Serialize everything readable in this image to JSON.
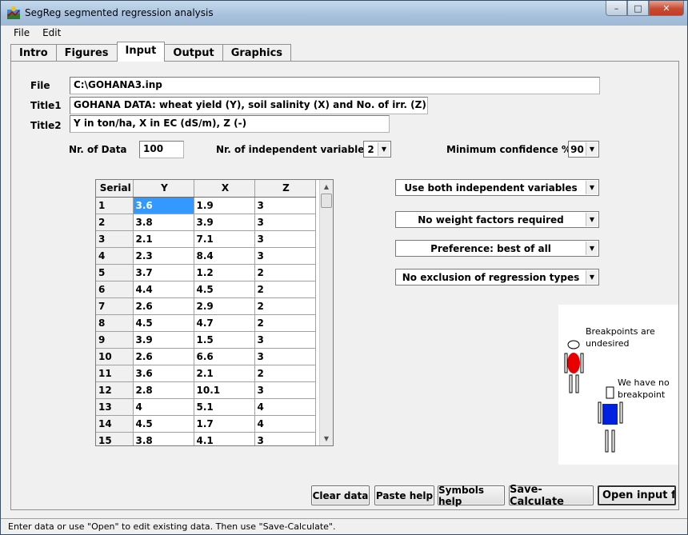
{
  "window": {
    "title": "SegReg segmented regression analysis",
    "controls": {
      "minimize": "–",
      "maximize": "□",
      "close": "✕"
    }
  },
  "menu": [
    "File",
    "Edit"
  ],
  "tabs": [
    {
      "label": "Intro",
      "active": false
    },
    {
      "label": "Figures",
      "active": false
    },
    {
      "label": "Input",
      "active": true
    },
    {
      "label": "Output",
      "active": false
    },
    {
      "label": "Graphics",
      "active": false
    }
  ],
  "form": {
    "file_label": "File",
    "file_value": "C:\\GOHANA3.inp",
    "title1_label": "Title1",
    "title1_value": "GOHANA DATA: wheat yield (Y), soil salinity (X) and No. of irr. (Z)",
    "title2_label": "Title2",
    "title2_value": "Y in ton/ha, X in EC (dS/m), Z (-)",
    "nr_data_label": "Nr. of Data",
    "nr_data_value": "100",
    "nr_indep_label": "Nr. of independent variables",
    "nr_indep_value": "2",
    "min_conf_label": "Minimum confidence %",
    "min_conf_value": "90"
  },
  "options": {
    "variables": "Use both independent variables",
    "weights": "No weight factors required",
    "preference": "Preference: best of all",
    "exclusion": "No exclusion of regression types"
  },
  "table": {
    "headers": [
      "Serial",
      "Y",
      "X",
      "Z"
    ],
    "rows": [
      [
        "1",
        "3.6",
        "1.9",
        "3"
      ],
      [
        "2",
        "3.8",
        "3.9",
        "3"
      ],
      [
        "3",
        "2.1",
        "7.1",
        "3"
      ],
      [
        "4",
        "2.3",
        "8.4",
        "3"
      ],
      [
        "5",
        "3.7",
        "1.2",
        "2"
      ],
      [
        "6",
        "4.4",
        "4.5",
        "2"
      ],
      [
        "7",
        "2.6",
        "2.9",
        "2"
      ],
      [
        "8",
        "4.5",
        "4.7",
        "2"
      ],
      [
        "9",
        "3.9",
        "1.5",
        "3"
      ],
      [
        "10",
        "2.6",
        "6.6",
        "3"
      ],
      [
        "11",
        "3.6",
        "2.1",
        "2"
      ],
      [
        "12",
        "2.8",
        "10.1",
        "3"
      ],
      [
        "13",
        "4",
        "5.1",
        "4"
      ],
      [
        "14",
        "4.5",
        "1.7",
        "4"
      ],
      [
        "15",
        "3.8",
        "4.1",
        "3"
      ]
    ]
  },
  "illustration": {
    "text1": [
      "Breakpoints are",
      "undesired"
    ],
    "text2": [
      "We have no",
      "breakpoint"
    ],
    "colors": {
      "red_figure": "#e80000",
      "blue_figure": "#0022e0"
    }
  },
  "buttons": {
    "clear_data": "Clear data",
    "paste_help": "Paste help",
    "symbols_help": "Symbols help",
    "save_calculate": "Save-Calculate",
    "open_input": "Open input file"
  },
  "status": "Enter data or use \"Open\" to edit existing data. Then use \"Save-Calculate\"."
}
